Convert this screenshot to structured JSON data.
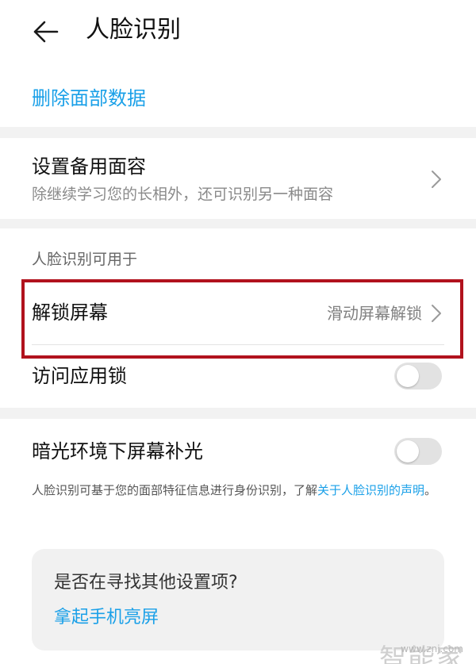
{
  "header": {
    "title": "人脸识别"
  },
  "delete_face_data": "删除面部数据",
  "alternate_face": {
    "title": "设置备用面容",
    "subtitle": "除继续学习您的长相外，还可识别另一种面容"
  },
  "usage_section": {
    "label": "人脸识别可用于",
    "unlock_screen": {
      "title": "解锁屏幕",
      "value": "滑动屏幕解锁"
    },
    "app_lock": {
      "title": "访问应用锁",
      "enabled": false
    }
  },
  "low_light": {
    "title": "暗光环境下屏幕补光",
    "enabled": false
  },
  "privacy_note": {
    "text": "人脸识别可基于您的面部特征信息进行身份识别，了解",
    "link": "关于人脸识别的声明",
    "suffix": "。"
  },
  "suggestion_card": {
    "question": "是否在寻找其他设置项?",
    "link": "拿起手机亮屏"
  },
  "watermark": {
    "brand": "智能家",
    "url": "www.znj.com"
  },
  "colors": {
    "accent": "#1aa0e8",
    "highlight_border": "#b1121d",
    "band": "#f2f2f2"
  },
  "icons": {
    "back": "arrow-left-icon",
    "chevron": "chevron-right-icon"
  }
}
